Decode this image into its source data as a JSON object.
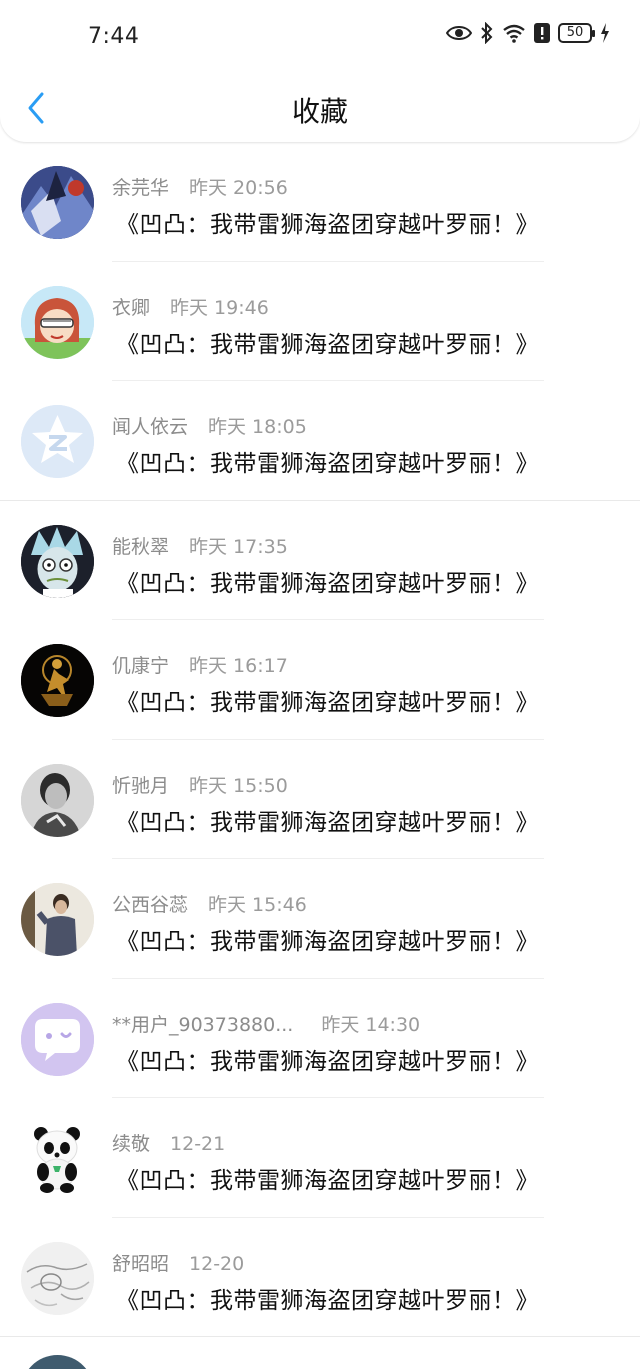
{
  "status_bar": {
    "time": "7:44",
    "battery": "50"
  },
  "nav": {
    "title": "收藏"
  },
  "items": [
    {
      "name": "余芫华",
      "time": "昨天 20:56",
      "title": "《凹凸：我带雷狮海盗团穿越叶罗丽！》",
      "avatar": "anime-blue"
    },
    {
      "name": "衣卿",
      "time": "昨天 19:46",
      "title": "《凹凸：我带雷狮海盗团穿越叶罗丽！》",
      "avatar": "cartoon-girl"
    },
    {
      "name": "闻人依云",
      "time": "昨天 18:05",
      "title": "《凹凸：我带雷狮海盗团穿越叶罗丽！》",
      "avatar": "default-z"
    },
    {
      "name": "能秋翠",
      "time": "昨天 17:35",
      "title": "《凹凸：我带雷狮海盗团穿越叶罗丽！》",
      "avatar": "rick"
    },
    {
      "name": "仉康宁",
      "time": "昨天 16:17",
      "title": "《凹凸：我带雷狮海盗团穿越叶罗丽！》",
      "avatar": "golden-dancer"
    },
    {
      "name": "忻驰月",
      "time": "昨天 15:50",
      "title": "《凹凸：我带雷狮海盗团穿越叶罗丽！》",
      "avatar": "bw-man"
    },
    {
      "name": "公西谷蕊",
      "time": "昨天 15:46",
      "title": "《凹凸：我带雷狮海盗团穿越叶罗丽！》",
      "avatar": "man-sweater"
    },
    {
      "name": "**用户_90373880...",
      "time": "昨天 14:30",
      "title": "《凹凸：我带雷狮海盗团穿越叶罗丽！》",
      "avatar": "purple-chat"
    },
    {
      "name": "续敬",
      "time": "12-21",
      "title": "《凹凸：我带雷狮海盗团穿越叶罗丽！》",
      "avatar": "panda"
    },
    {
      "name": "舒昭昭",
      "time": "12-20",
      "title": "《凹凸：我带雷狮海盗团穿越叶罗丽！》",
      "avatar": "sketch"
    }
  ],
  "colors": {
    "accent": "#2a9df4",
    "meta": "#8c8c8c",
    "divider": "#eeeeee"
  }
}
